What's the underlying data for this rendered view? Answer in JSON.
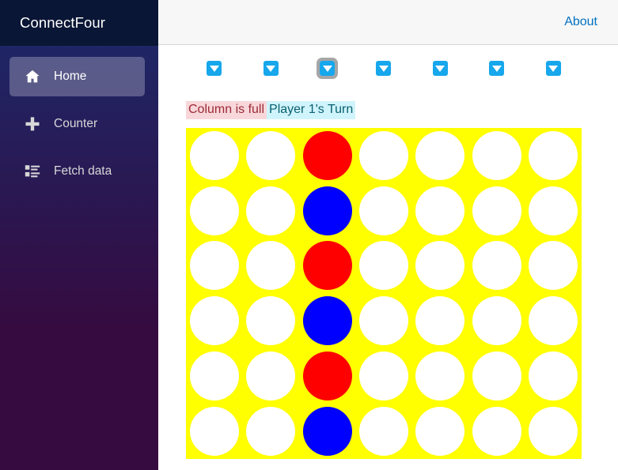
{
  "app": {
    "title": "ConnectFour"
  },
  "sidebar": {
    "brand": "ConnectFour",
    "items": [
      {
        "label": "Home",
        "icon": "home-icon",
        "active": true
      },
      {
        "label": "Counter",
        "icon": "plus-icon",
        "active": false
      },
      {
        "label": "Fetch data",
        "icon": "list-icon",
        "active": false
      }
    ]
  },
  "topbar": {
    "about_label": "About"
  },
  "game": {
    "columns": 7,
    "rows": 6,
    "drop_buttons": [
      {
        "label": "▼",
        "column": 1,
        "focused": false
      },
      {
        "label": "▼",
        "column": 2,
        "focused": false
      },
      {
        "label": "▼",
        "column": 3,
        "focused": true
      },
      {
        "label": "▼",
        "column": 4,
        "focused": false
      },
      {
        "label": "▼",
        "column": 5,
        "focused": false
      },
      {
        "label": "▼",
        "column": 6,
        "focused": false
      },
      {
        "label": "▼",
        "column": 7,
        "focused": false
      }
    ],
    "status": {
      "error": "Column is full",
      "turn": "Player 1's Turn"
    },
    "board_color": "#ffff00",
    "player_colors": {
      "player1": "#ff0000",
      "player2": "#0000ff",
      "empty": "#ffffff"
    },
    "board": [
      [
        "empty",
        "empty",
        "red",
        "empty",
        "empty",
        "empty",
        "empty"
      ],
      [
        "empty",
        "empty",
        "blue",
        "empty",
        "empty",
        "empty",
        "empty"
      ],
      [
        "empty",
        "empty",
        "red",
        "empty",
        "empty",
        "empty",
        "empty"
      ],
      [
        "empty",
        "empty",
        "blue",
        "empty",
        "empty",
        "empty",
        "empty"
      ],
      [
        "empty",
        "empty",
        "red",
        "empty",
        "empty",
        "empty",
        "empty"
      ],
      [
        "empty",
        "empty",
        "blue",
        "empty",
        "empty",
        "empty",
        "empty"
      ]
    ]
  }
}
